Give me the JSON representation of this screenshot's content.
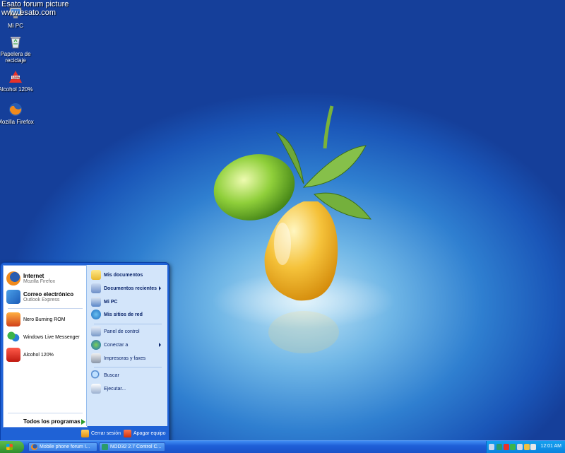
{
  "watermark": {
    "line1": "Esato forum picture",
    "line2": "www.esato.com"
  },
  "desktop_icons": [
    {
      "label": "Mi PC",
      "icon": "computer-icon"
    },
    {
      "label": "Papelera de reciclaje",
      "icon": "recycle-bin-icon"
    },
    {
      "label": "Alcohol 120%",
      "icon": "alcohol-icon"
    },
    {
      "label": "Mozilla Firefox",
      "icon": "firefox-icon"
    }
  ],
  "start_menu": {
    "pinned": [
      {
        "title": "Internet",
        "subtitle": "Mozilla Firefox",
        "icon": "firefox-icon"
      },
      {
        "title": "Correo electrónico",
        "subtitle": "Outlook Express",
        "icon": "outlook-icon"
      }
    ],
    "recent": [
      {
        "label": "Nero Burning ROM",
        "icon": "nero-icon"
      },
      {
        "label": "Windows Live Messenger",
        "icon": "messenger-icon"
      },
      {
        "label": "Alcohol 120%",
        "icon": "alcohol-icon"
      }
    ],
    "all_programs": "Todos los programas",
    "right_items": [
      {
        "label": "Mis documentos",
        "icon": "folder-icon"
      },
      {
        "label": "Documentos recientes",
        "icon": "recent-docs-icon"
      },
      {
        "label": "Mi PC",
        "icon": "computer-icon"
      },
      {
        "label": "Mis sitios de red",
        "icon": "network-icon"
      },
      {
        "label": "Panel de control",
        "icon": "control-panel-icon"
      },
      {
        "label": "Conectar a",
        "icon": "connect-icon"
      },
      {
        "label": "Impresoras y faxes",
        "icon": "printer-icon"
      },
      {
        "label": "Buscar",
        "icon": "search-icon"
      },
      {
        "label": "Ejecutar...",
        "icon": "run-icon"
      }
    ],
    "logoff": "Cerrar sesión",
    "shutdown": "Apagar equipo"
  },
  "taskbar": {
    "tasks": [
      {
        "label": "Mobile phone forum I...",
        "icon": "firefox-icon"
      },
      {
        "label": "NOD32 2.7 Control C...",
        "icon": "nod32-icon"
      }
    ],
    "clock": "12:01 AM"
  },
  "colors": {
    "taskbar": "#1e5fd8",
    "start_button": "#2f8d2a",
    "tray": "#0b83df"
  }
}
